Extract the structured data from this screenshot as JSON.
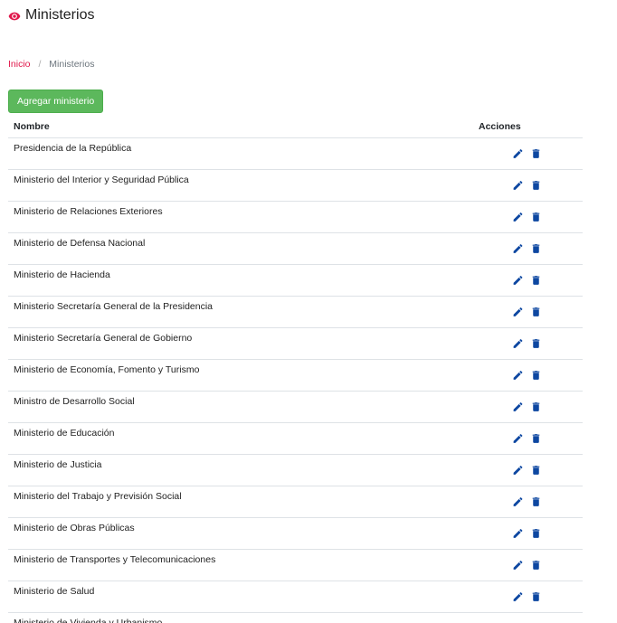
{
  "header": {
    "title": "Ministerios",
    "icon": "eye-icon",
    "icon_color": "#e0174a"
  },
  "breadcrumb": {
    "home": "Inicio",
    "separator": "/",
    "current": "Ministerios"
  },
  "toolbar": {
    "add_label": "Agregar ministerio",
    "add_color": "#5cb85c"
  },
  "table": {
    "columns": [
      "Nombre",
      "Acciones"
    ],
    "action_icons": [
      "pencil-icon",
      "trash-icon"
    ],
    "action_color": "#0d47a1",
    "rows": [
      "Presidencia de la República",
      "Ministerio del Interior y Seguridad Pública",
      "Ministerio de Relaciones Exteriores",
      "Ministerio de Defensa Nacional",
      "Ministerio de Hacienda",
      "Ministerio Secretaría General de la Presidencia",
      "Ministerio Secretaría General de Gobierno",
      "Ministerio de Economía, Fomento y Turismo",
      "Ministro de Desarrollo Social",
      "Ministerio de Educación",
      "Ministerio de Justicia",
      "Ministerio del Trabajo y Previsión Social",
      "Ministerio de Obras Públicas",
      "Ministerio de Transportes y Telecomunicaciones",
      "Ministerio de Salud",
      "Ministerio de Vivienda y Urbanismo"
    ]
  }
}
